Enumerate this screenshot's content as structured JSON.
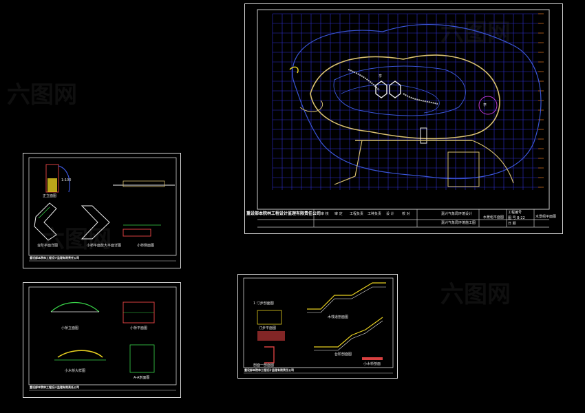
{
  "watermark": "六图网",
  "main_sheet": {
    "company": "重设部本院林工程设计监理有限责任公司",
    "title": "水景组平面图",
    "project_a": "嘉兴气象局环境设计",
    "project_b": "嘉兴气象局环境施工图",
    "col_labels": [
      "审 核",
      "审 定",
      "工程负责",
      "工种负责",
      "设 计",
      "校 对"
    ],
    "right_info": [
      "工程编号",
      "图 号 B-22",
      "日 期"
    ],
    "right_note": "水景组平面图",
    "garden_labels": [
      "亭",
      "亭"
    ]
  },
  "sheet_tl": {
    "company": "重设部本院林工程设计监理有限责任公司",
    "labels": [
      "正立面图",
      "1:100",
      "台阶平面详图",
      "小桥平面放大平面详图",
      "小桥侧面图"
    ]
  },
  "sheet_bl": {
    "company": "重设部本院林工程设计监理有限责任公司",
    "labels": [
      "小桥立面图",
      "小桥平面图",
      "小木桥大样图",
      "A-A剖面图"
    ]
  },
  "sheet_br": {
    "company": "重设部本院林工程设计监理有限责任公司",
    "labels": [
      "1 汀步剖面图",
      "汀步平面图",
      "木栈道剖面图",
      "台阶剖面图",
      "剖面一剖面图",
      "小木桥剖面"
    ]
  },
  "colors": {
    "grid_blue": "#2e2ecf",
    "grid_orange": "#c86a1a",
    "path_yellow": "#d8c070",
    "water_blue": "#3a55d8",
    "green": "#3ad84a",
    "red": "#e03030"
  }
}
